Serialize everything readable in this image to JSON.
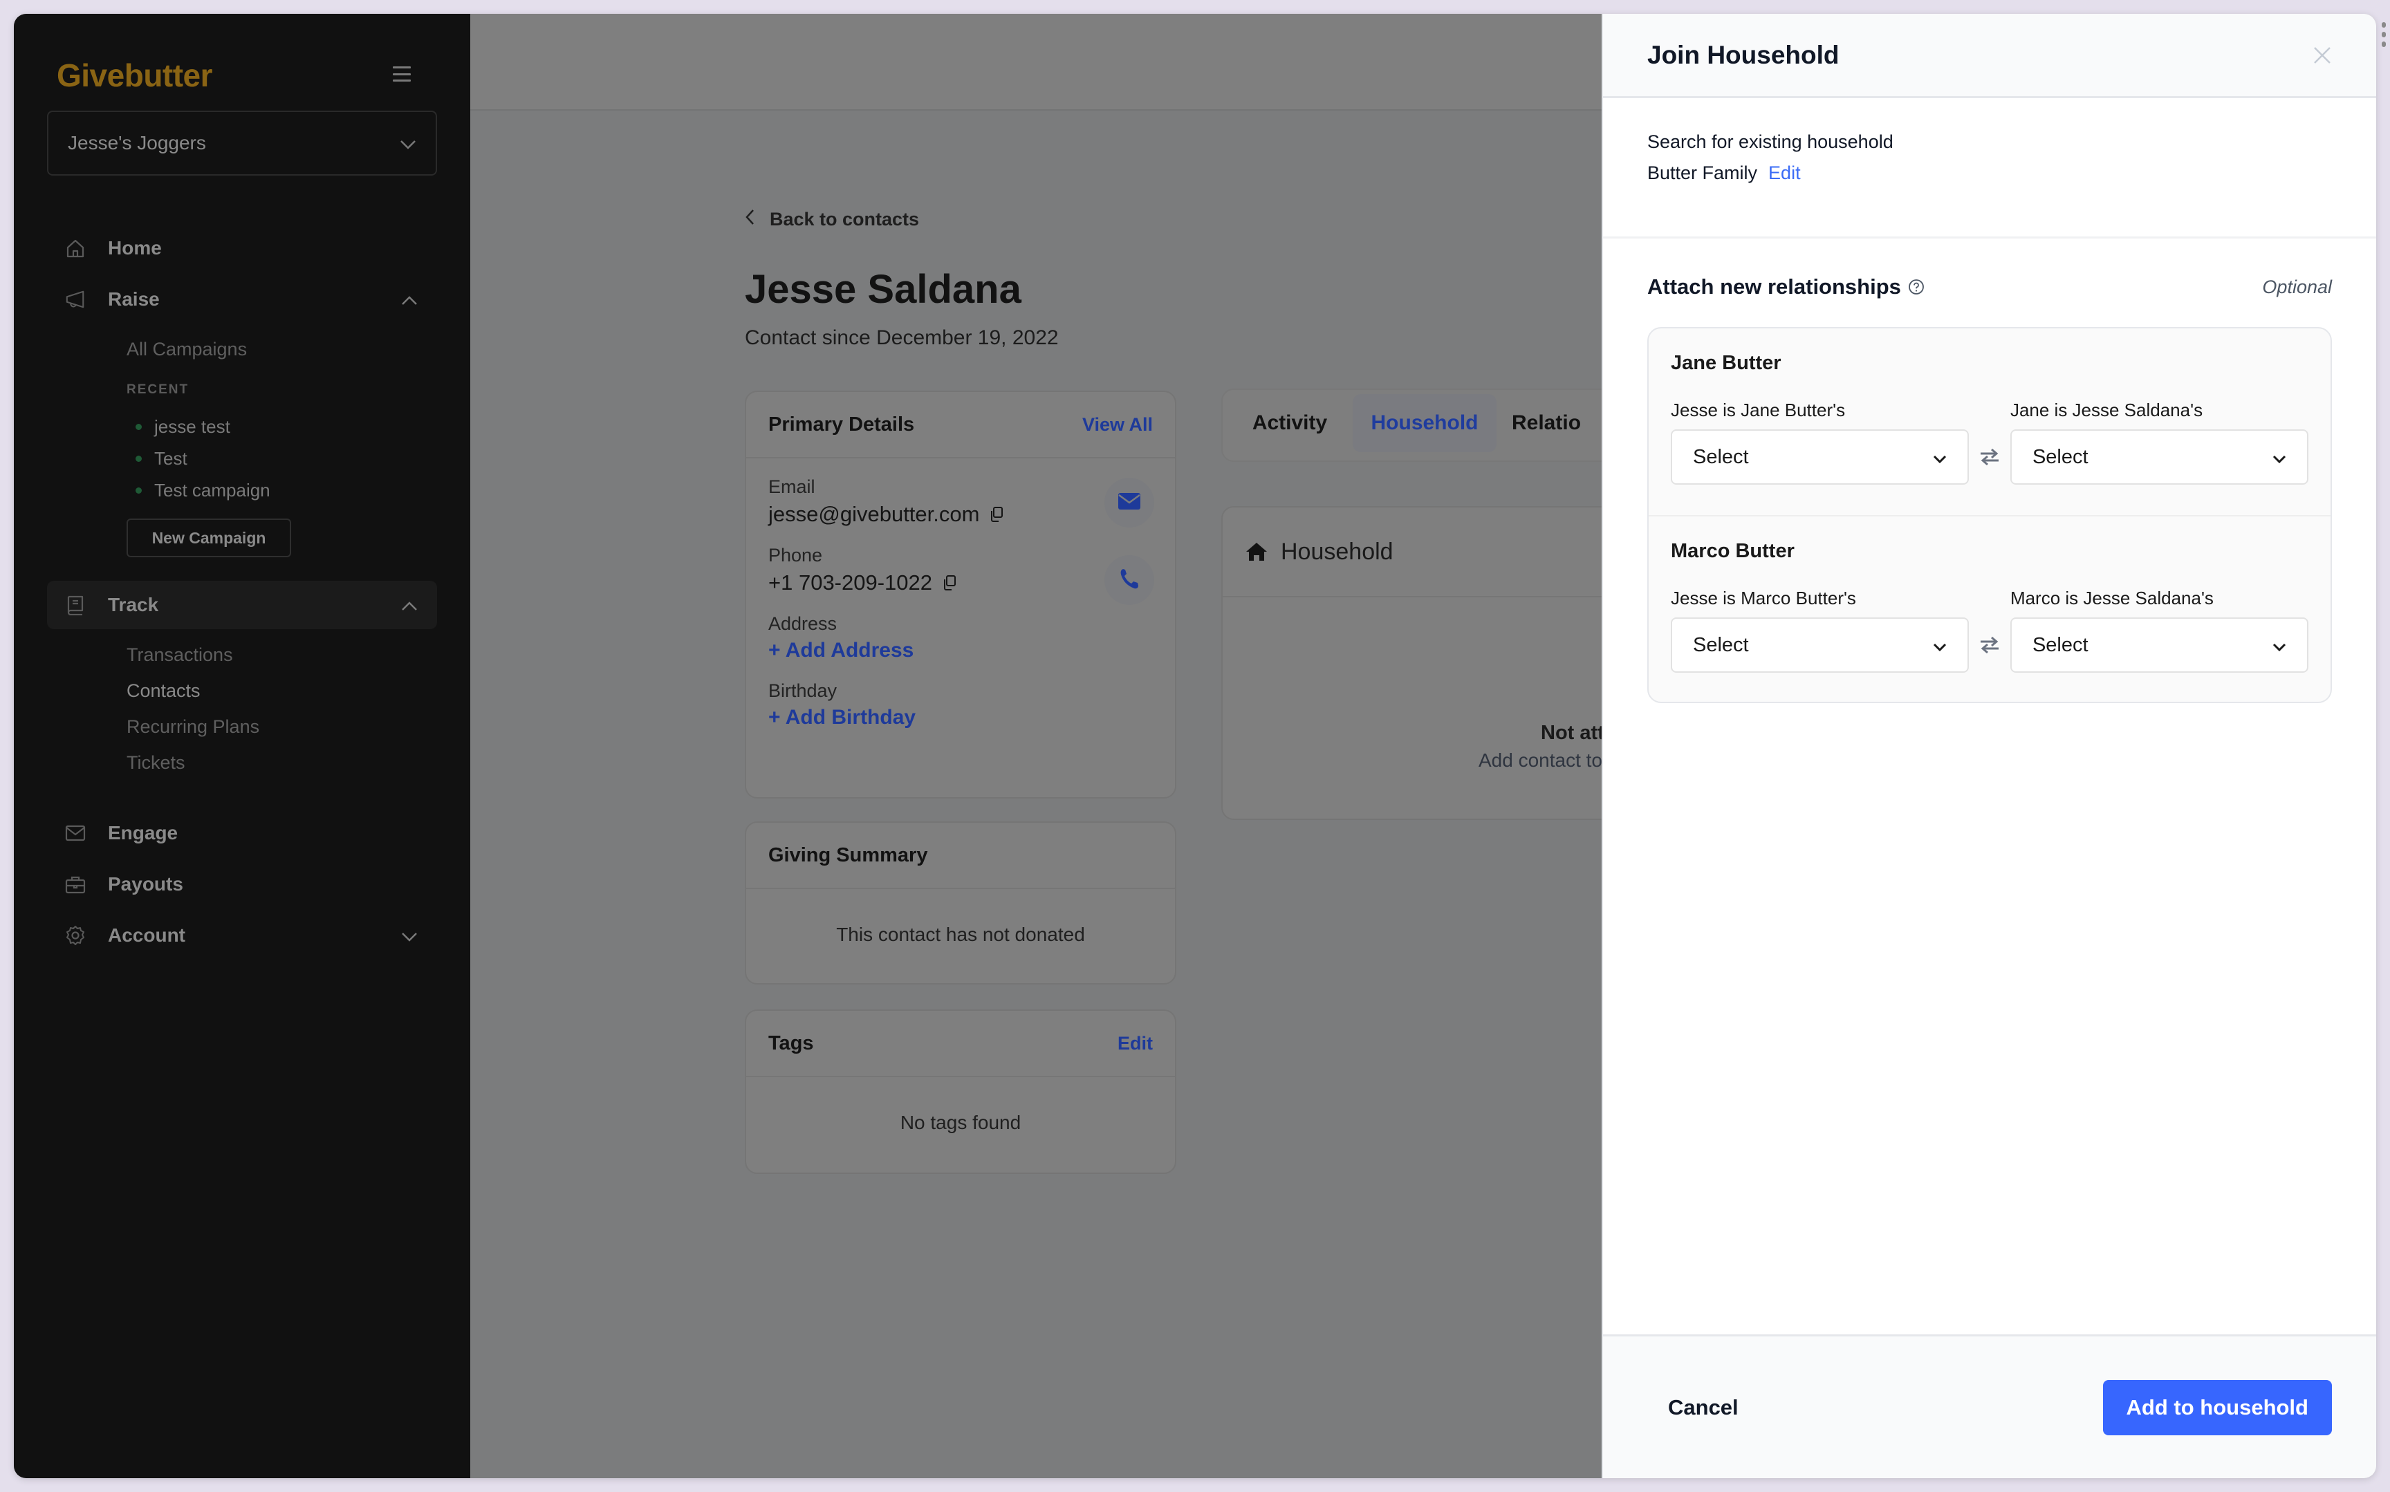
{
  "sidebar": {
    "logo": "Givebutter",
    "org_selector": "Jesse's Joggers",
    "nav": {
      "home": "Home",
      "raise": "Raise",
      "track": "Track",
      "engage": "Engage",
      "payouts": "Payouts",
      "account": "Account"
    },
    "raise_items": {
      "all_campaigns": "All Campaigns",
      "recent_label": "RECENT",
      "recent": [
        "jesse test",
        "Test",
        "Test campaign"
      ],
      "new_campaign": "New Campaign"
    },
    "track_items": [
      "Transactions",
      "Contacts",
      "Recurring Plans",
      "Tickets"
    ]
  },
  "contact": {
    "back_link": "Back to contacts",
    "name": "Jesse Saldana",
    "since": "Contact since December 19, 2022",
    "primary_details": {
      "title": "Primary Details",
      "view_all": "View All",
      "email_label": "Email",
      "email": "jesse@givebutter.com",
      "phone_label": "Phone",
      "phone": "+1 703-209-1022",
      "address_label": "Address",
      "add_address": "+ Add Address",
      "birthday_label": "Birthday",
      "add_birthday": "+ Add Birthday"
    },
    "giving_summary": {
      "title": "Giving Summary",
      "empty": "This contact has not donated"
    },
    "tags": {
      "title": "Tags",
      "edit": "Edit",
      "empty": "No tags found"
    },
    "tabs": [
      "Activity",
      "Household",
      "Relatio"
    ],
    "active_tab": "Household",
    "household_card": {
      "title": "Household",
      "empty_title": "Not att",
      "empty_sub": "Add contact to"
    }
  },
  "drawer": {
    "title": "Join Household",
    "search_label": "Search for existing household",
    "selected_household": "Butter Family",
    "edit_label": "Edit",
    "relationships_title": "Attach new relationships",
    "optional_label": "Optional",
    "people": [
      {
        "name": "Jane Butter",
        "left_label": "Jesse is Jane Butter's",
        "left_value": "Select",
        "right_label": "Jane is Jesse Saldana's",
        "right_value": "Select"
      },
      {
        "name": "Marco Butter",
        "left_label": "Jesse is Marco Butter's",
        "left_value": "Select",
        "right_label": "Marco is Jesse Saldana's",
        "right_value": "Select"
      }
    ],
    "cancel_label": "Cancel",
    "submit_label": "Add to household"
  },
  "colors": {
    "brand": "#8a6414",
    "primary": "#3766fe",
    "link": "#3b6cf6",
    "sidebar_bg": "#111111",
    "recent_dot": "#1f5a36"
  }
}
